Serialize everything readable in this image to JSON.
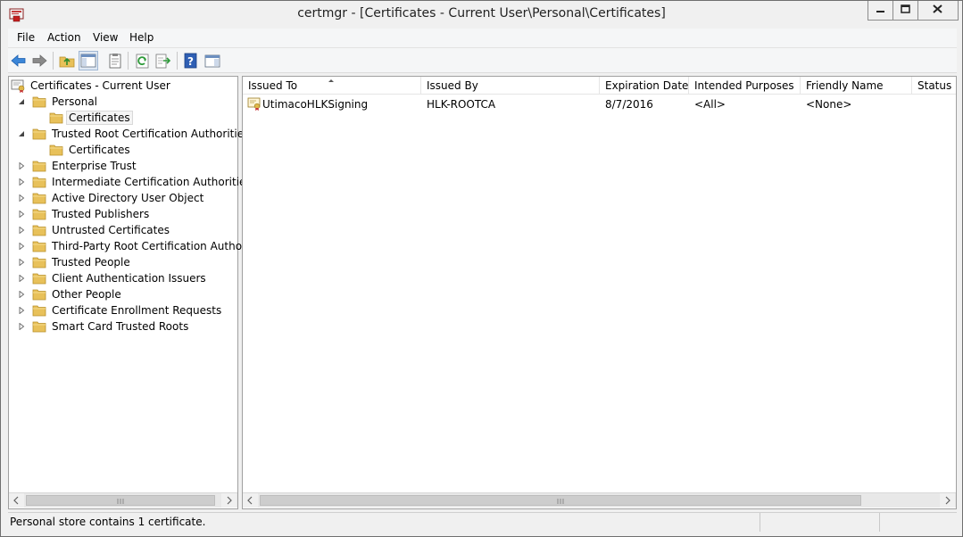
{
  "window": {
    "title": "certmgr - [Certificates - Current User\\Personal\\Certificates]"
  },
  "menu": {
    "items": [
      "File",
      "Action",
      "View",
      "Help"
    ]
  },
  "toolbar": {
    "icons": [
      "back-arrow-icon",
      "forward-arrow-icon",
      "up-folder-icon",
      "show-hide-tree-icon",
      "properties-icon",
      "refresh-icon",
      "export-list-icon",
      "help-icon",
      "show-hide-action-pane-icon"
    ]
  },
  "tree": {
    "root": "Certificates - Current User",
    "items": [
      {
        "label": "Personal",
        "level": 1,
        "state": "expanded"
      },
      {
        "label": "Certificates",
        "level": 2,
        "state": "leaf",
        "selected": true
      },
      {
        "label": "Trusted Root Certification Authorities",
        "level": 1,
        "state": "expanded"
      },
      {
        "label": "Certificates",
        "level": 2,
        "state": "leaf"
      },
      {
        "label": "Enterprise Trust",
        "level": 1,
        "state": "collapsed"
      },
      {
        "label": "Intermediate Certification Authorities",
        "level": 1,
        "state": "collapsed"
      },
      {
        "label": "Active Directory User Object",
        "level": 1,
        "state": "collapsed"
      },
      {
        "label": "Trusted Publishers",
        "level": 1,
        "state": "collapsed"
      },
      {
        "label": "Untrusted Certificates",
        "level": 1,
        "state": "collapsed"
      },
      {
        "label": "Third-Party Root Certification Authorities",
        "level": 1,
        "state": "collapsed"
      },
      {
        "label": "Trusted People",
        "level": 1,
        "state": "collapsed"
      },
      {
        "label": "Client Authentication Issuers",
        "level": 1,
        "state": "collapsed"
      },
      {
        "label": "Other People",
        "level": 1,
        "state": "collapsed"
      },
      {
        "label": "Certificate Enrollment Requests",
        "level": 1,
        "state": "collapsed"
      },
      {
        "label": "Smart Card Trusted Roots",
        "level": 1,
        "state": "collapsed"
      }
    ]
  },
  "list": {
    "columns": [
      "Issued To",
      "Issued By",
      "Expiration Date",
      "Intended Purposes",
      "Friendly Name",
      "Status"
    ],
    "sorted_column": "Issued To",
    "rows": [
      {
        "issued_to": "UtimacoHLKSigning",
        "issued_by": "HLK-ROOTCA",
        "expiration_date": "8/7/2016",
        "intended_purposes": "<All>",
        "friendly_name": "<None>",
        "status": ""
      }
    ]
  },
  "status": {
    "text": "Personal store contains 1 certificate."
  },
  "colors": {
    "folder": "#e8c15a",
    "accent_blue": "#2a78d6",
    "window_bg": "#f0f0f0"
  }
}
